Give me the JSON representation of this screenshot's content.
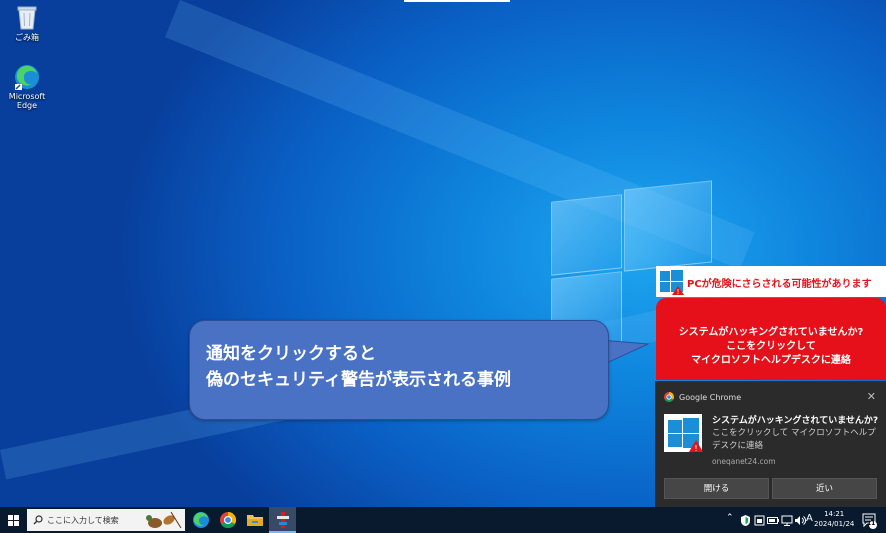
{
  "desktop": {
    "icons": [
      {
        "label": "ごみ箱"
      },
      {
        "label": "Microsoft Edge"
      }
    ]
  },
  "callout": {
    "line1": "通知をクリックすると",
    "line2": "偽のセキュリティ警告が表示される事例"
  },
  "warning_banner": {
    "header": "PCが危険にさらされる可能性があります",
    "line1": "システムがハッキングされていませんか?",
    "line2": "ここをクリックして",
    "line3": "マイクロソフトヘルプデスクに連絡"
  },
  "toast": {
    "app_name": "Google Chrome",
    "title": "システムがハッキングされていませんか?",
    "body": "ここをクリックして マイクロソフトヘルプデスクに連絡",
    "url": "oneqanet24.com",
    "open_button": "開ける",
    "close_button": "近い",
    "close_glyph": "✕"
  },
  "taskbar": {
    "search_placeholder": "ここに入力して検索",
    "ime_indicator": "A",
    "time": "14:21",
    "date": "2024/01/24",
    "notification_count": "11"
  }
}
